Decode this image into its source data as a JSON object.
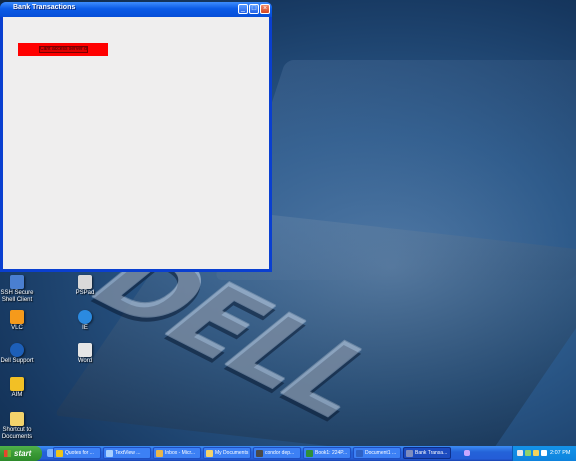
{
  "window": {
    "title": "Bank Transactions",
    "error_label": "Cant access server data"
  },
  "desktop_icons": [
    {
      "id": "ssh",
      "label_line1": "SSH Secure",
      "label_line2": "Shell Client",
      "color": "#4a7fd1"
    },
    {
      "id": "psp",
      "label_line1": "PSPad",
      "label_line2": "",
      "color": "#d9d9d9"
    },
    {
      "id": "vlc",
      "label_line1": "VLC",
      "label_line2": "",
      "color": "#f59a1b"
    },
    {
      "id": "ie",
      "label_line1": "IE",
      "label_line2": "",
      "color": "#2b8ae0"
    },
    {
      "id": "support",
      "label_line1": "Dell Support",
      "label_line2": "",
      "color": "#1d5fb8"
    },
    {
      "id": "word",
      "label_line1": "Word",
      "label_line2": "",
      "color": "#e6e6e6"
    },
    {
      "id": "aim",
      "label_line1": "AIM",
      "label_line2": "",
      "color": "#f2c025"
    },
    {
      "id": "docs",
      "label_line1": "Shortcut to",
      "label_line2": "Documents",
      "color": "#f3d36b"
    }
  ],
  "wallpaper": {
    "brand": "DELL"
  },
  "taskbar": {
    "start_label": "start",
    "tasks": [
      {
        "label": "Quotes for ...",
        "color": "#f0c419",
        "active": false
      },
      {
        "label": "TextView ...",
        "color": "#a8d0ff",
        "active": false
      },
      {
        "label": "Inbox - Micr...",
        "color": "#e9b64a",
        "active": false
      },
      {
        "label": "My Documents",
        "color": "#f5d36a",
        "active": false
      },
      {
        "label": "condor dep...",
        "color": "#4a4a4a",
        "active": false
      },
      {
        "label": "Book1: 224P...",
        "color": "#2f8f3a",
        "active": false
      },
      {
        "label": "Document1 ...",
        "color": "#2e62c6",
        "active": false
      },
      {
        "label": "Bank Transa...",
        "color": "#7e8dbf",
        "active": true
      }
    ],
    "clock": "2:07 PM"
  },
  "colors": {
    "title_bar": "#0b5be6",
    "client_bg": "#efeeee",
    "error_bg": "#ff0000",
    "taskbar": "#245dd7",
    "start_green": "#3a9a36"
  }
}
